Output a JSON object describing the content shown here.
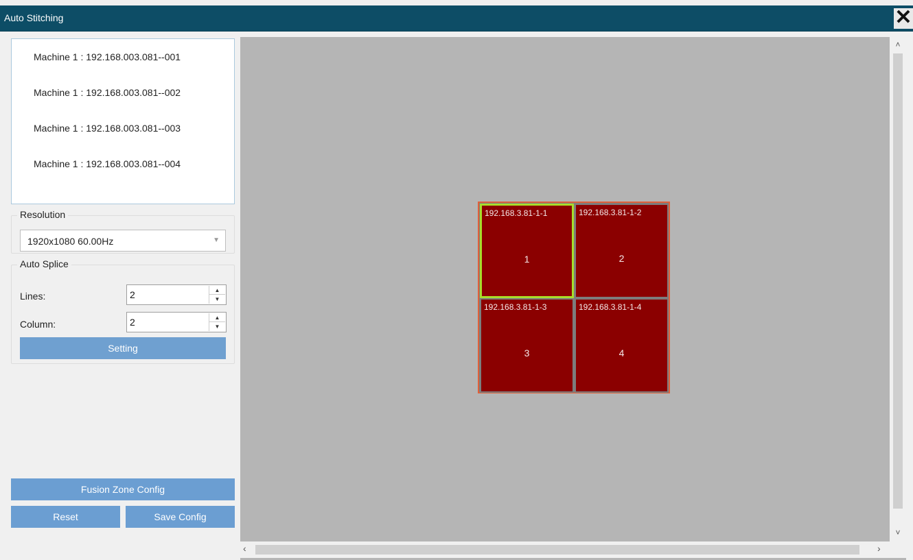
{
  "window": {
    "title": "Auto Stitching",
    "close_glyph": "✕"
  },
  "machines": [
    "Machine 1 : 192.168.003.081--001",
    "Machine 1 : 192.168.003.081--002",
    "Machine 1 : 192.168.003.081--003",
    "Machine 1 : 192.168.003.081--004"
  ],
  "resolution": {
    "label": "Resolution",
    "value": "1920x1080 60.00Hz"
  },
  "auto_splice": {
    "label": "Auto Splice",
    "lines_label": "Lines:",
    "lines_value": "2",
    "column_label": "Column:",
    "column_value": "2",
    "setting_label": "Setting"
  },
  "buttons": {
    "fusion": "Fusion Zone Config",
    "reset": "Reset",
    "save": "Save Config"
  },
  "wall": {
    "cells": [
      {
        "ip": "192.168.3.81-1-1",
        "num": "1",
        "selected": true
      },
      {
        "ip": "192.168.3.81-1-2",
        "num": "2",
        "selected": false
      },
      {
        "ip": "192.168.3.81-1-3",
        "num": "3",
        "selected": false
      },
      {
        "ip": "192.168.3.81-1-4",
        "num": "4",
        "selected": false
      }
    ]
  },
  "colors": {
    "titlebar": "#0d4d66",
    "cell_fill": "#8b0000",
    "selected_border": "#a8dd2a",
    "wall_border": "#e0603a",
    "button": "#6b9ed2"
  }
}
